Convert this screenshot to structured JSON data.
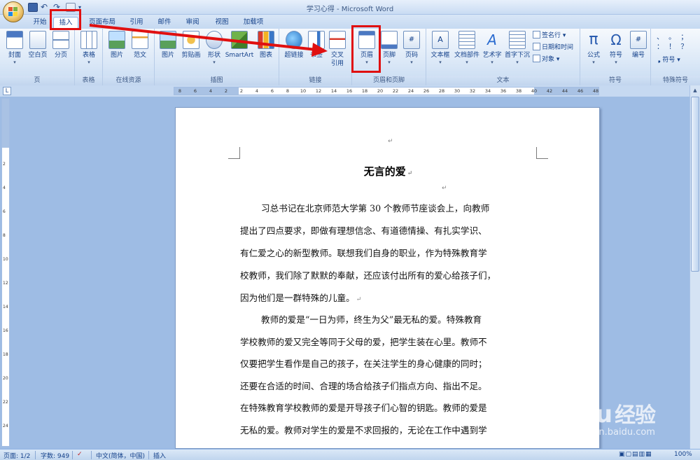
{
  "window": {
    "title": "学习心得 - Microsoft Word"
  },
  "tabs": [
    {
      "label": "开始",
      "active": false
    },
    {
      "label": "插入",
      "active": true
    },
    {
      "label": "页面布局",
      "active": false
    },
    {
      "label": "引用",
      "active": false
    },
    {
      "label": "邮件",
      "active": false
    },
    {
      "label": "审阅",
      "active": false
    },
    {
      "label": "视图",
      "active": false
    },
    {
      "label": "加载项",
      "active": false
    }
  ],
  "ribbon": {
    "groups": {
      "pages": "页",
      "tables": "表格",
      "online": "在线资源",
      "illustrations": "插图",
      "links": "链接",
      "header_footer": "页眉和页脚",
      "text": "文本",
      "symbols": "符号",
      "special_symbols": "特殊符号"
    },
    "buttons": {
      "cover": "封面",
      "blank_page": "空白页",
      "page_break": "分页",
      "table": "表格",
      "picture": "图片",
      "template": "范文",
      "image": "图片",
      "clipart": "剪贴画",
      "shapes": "形状",
      "smartart": "SmartArt",
      "chart": "图表",
      "hyperlink": "超链接",
      "bookmark": "书签",
      "crossref_1": "交叉",
      "crossref_2": "引用",
      "header": "页眉",
      "footer": "页脚",
      "page_number": "页码",
      "textbox": "文本框",
      "quickparts": "文档部件",
      "wordart": "艺术字",
      "dropcap": "首字下沉",
      "signature": "签名行",
      "datetime": "日期和时间",
      "object": "对象",
      "equation": "公式",
      "symbol": "符号",
      "number": "编号",
      "symbol_menu": "符号",
      "special_chars": "、 。 ； ： ！ ？"
    }
  },
  "ruler": {
    "h_ticks": [
      "8",
      "6",
      "4",
      "2",
      "2",
      "4",
      "6",
      "8",
      "10",
      "12",
      "14",
      "16",
      "18",
      "20",
      "22",
      "24",
      "26",
      "28",
      "30",
      "32",
      "34",
      "36",
      "38",
      "40",
      "42",
      "44",
      "46",
      "48"
    ],
    "v_ticks": [
      "2",
      "4",
      "6",
      "8",
      "10",
      "12",
      "14",
      "16",
      "18",
      "20",
      "22",
      "24"
    ]
  },
  "document": {
    "title": "无言的爱",
    "para1_lines": [
      "习总书记在北京师范大学第 30 个教师节座谈会上，向教师",
      "提出了四点要求，即做有理想信念、有道德情操、有扎实学识、",
      "有仁爱之心的新型教师。联想我们自身的职业，作为特殊教育学",
      "校教师，我们除了默默的奉献，还应该付出所有的爱心给孩子们，",
      "因为他们是一群特殊的儿童。"
    ],
    "para2_lines": [
      "教师的爱是“一日为师，终生为父”最无私的爱。特殊教育",
      "学校教师的爱又完全等同于父母的爱，把学生装在心里。教师不",
      "仅要把学生看作是自己的孩子，在关注学生的身心健康的同时；",
      "还要在合适的时间、合理的场合给孩子们指点方向、指出不足。",
      "在特殊教育学校教师的爱是开导孩子们心智的钥匙。教师的爱是",
      "无私的爱。教师对学生的爱是不求回报的，无论在工作中遇到学"
    ]
  },
  "status": {
    "page": "页面: 1/2",
    "words": "字数: 949",
    "language": "中文(简体，中国)",
    "mode": "插入",
    "zoom": "100%"
  },
  "watermark": {
    "brand": "Baidu",
    "cn": "经验",
    "url": "jingyan.baidu.com"
  },
  "colors": {
    "annotation": "#e01010",
    "ribbon_text": "#15428b",
    "background": "#9ebce4"
  }
}
